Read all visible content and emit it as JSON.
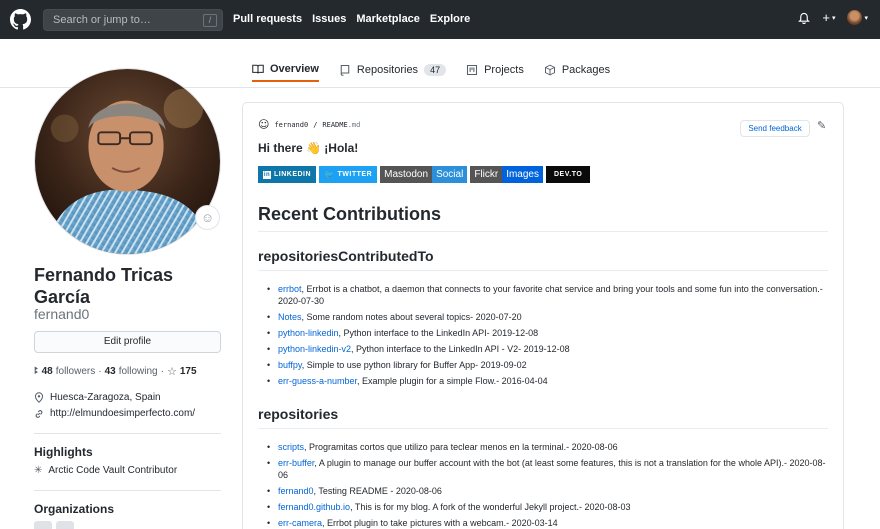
{
  "nav": {
    "search_placeholder": "Search or jump to…",
    "search_key": "/",
    "links": [
      "Pull requests",
      "Issues",
      "Marketplace",
      "Explore"
    ],
    "icons": [
      "bell-icon",
      "plus-icon",
      "avatar-menu"
    ]
  },
  "tabs": [
    {
      "label": "Overview",
      "icon": "book-icon",
      "active": true
    },
    {
      "label": "Repositories",
      "icon": "repo-icon",
      "count": "47"
    },
    {
      "label": "Projects",
      "icon": "project-icon"
    },
    {
      "label": "Packages",
      "icon": "package-icon"
    }
  ],
  "profile": {
    "name": "Fernando Tricas García",
    "login": "fernand0",
    "edit_label": "Edit profile",
    "followers_count": "48",
    "followers_label": "followers",
    "following_count": "43",
    "following_label": "following",
    "stars": "175",
    "location": "Huesca-Zaragoza, Spain",
    "website": "http://elmundoesimperfecto.com/",
    "highlights_title": "Highlights",
    "highlight": "Arctic Code Vault Contributor",
    "orgs_title": "Organizations"
  },
  "readme": {
    "owner": "fernand0",
    "sep": "/",
    "file": "README",
    "ext": ".md",
    "feedback_label": "Send feedback",
    "greeting": "Hi there 👋 ¡Hola!",
    "badges": {
      "linkedin": "LINKEDIN",
      "twitter": "TWITTER",
      "mastodon_left": "Mastodon",
      "mastodon_right": "Social",
      "flickr_left": "Flickr",
      "flickr_right": "Images",
      "devto": "DEV.TO"
    },
    "heading": "Recent Contributions",
    "sections": [
      {
        "title": "repositoriesContributedTo",
        "items": [
          {
            "link": "errbot",
            "text": ", Errbot is a chatbot, a daemon that connects to your favorite chat service and bring your tools and some fun into the conversation.- 2020-07-30"
          },
          {
            "link": "Notes",
            "text": ", Some random notes about several topics- 2020-07-20"
          },
          {
            "link": "python-linkedin",
            "text": ", Python interface to the LinkedIn API- 2019-12-08"
          },
          {
            "link": "python-linkedin-v2",
            "text": ", Python interface to the LinkedIn API - V2- 2019-12-08"
          },
          {
            "link": "buffpy",
            "text": ", Simple to use python library for Buffer App- 2019-09-02"
          },
          {
            "link": "err-guess-a-number",
            "text": ", Example plugin for a simple Flow.- 2016-04-04"
          }
        ]
      },
      {
        "title": "repositories",
        "items": [
          {
            "link": "scripts",
            "text": ", Programitas cortos que utilizo para teclear menos en la terminal.- 2020-08-06"
          },
          {
            "link": "err-buffer",
            "text": ", A plugin to manage our buffer account with the bot (at least some features, this is not a translation for the whole API).- 2020-08-06"
          },
          {
            "link": "fernand0",
            "text": ", Testing README - 2020-08-06"
          },
          {
            "link": "fernand0.github.io",
            "text": ", This is for my blog. A fork of the wonderful Jekyll project.- 2020-08-03"
          },
          {
            "link": "err-camera",
            "text": ", Errbot plugin to take pictures with a webcam.- 2020-03-14"
          }
        ]
      }
    ]
  },
  "colors": {
    "header_bg": "#24292e",
    "link": "#0366d6",
    "tab_active": "#e36209",
    "linkedin": "#0e76a8",
    "twitter": "#1da1f2",
    "mastodon_left": "#555555",
    "mastodon_right": "#2b90d9",
    "flickr_left": "#555555",
    "flickr_right": "#0063dc",
    "devto": "#0a0a0a"
  }
}
